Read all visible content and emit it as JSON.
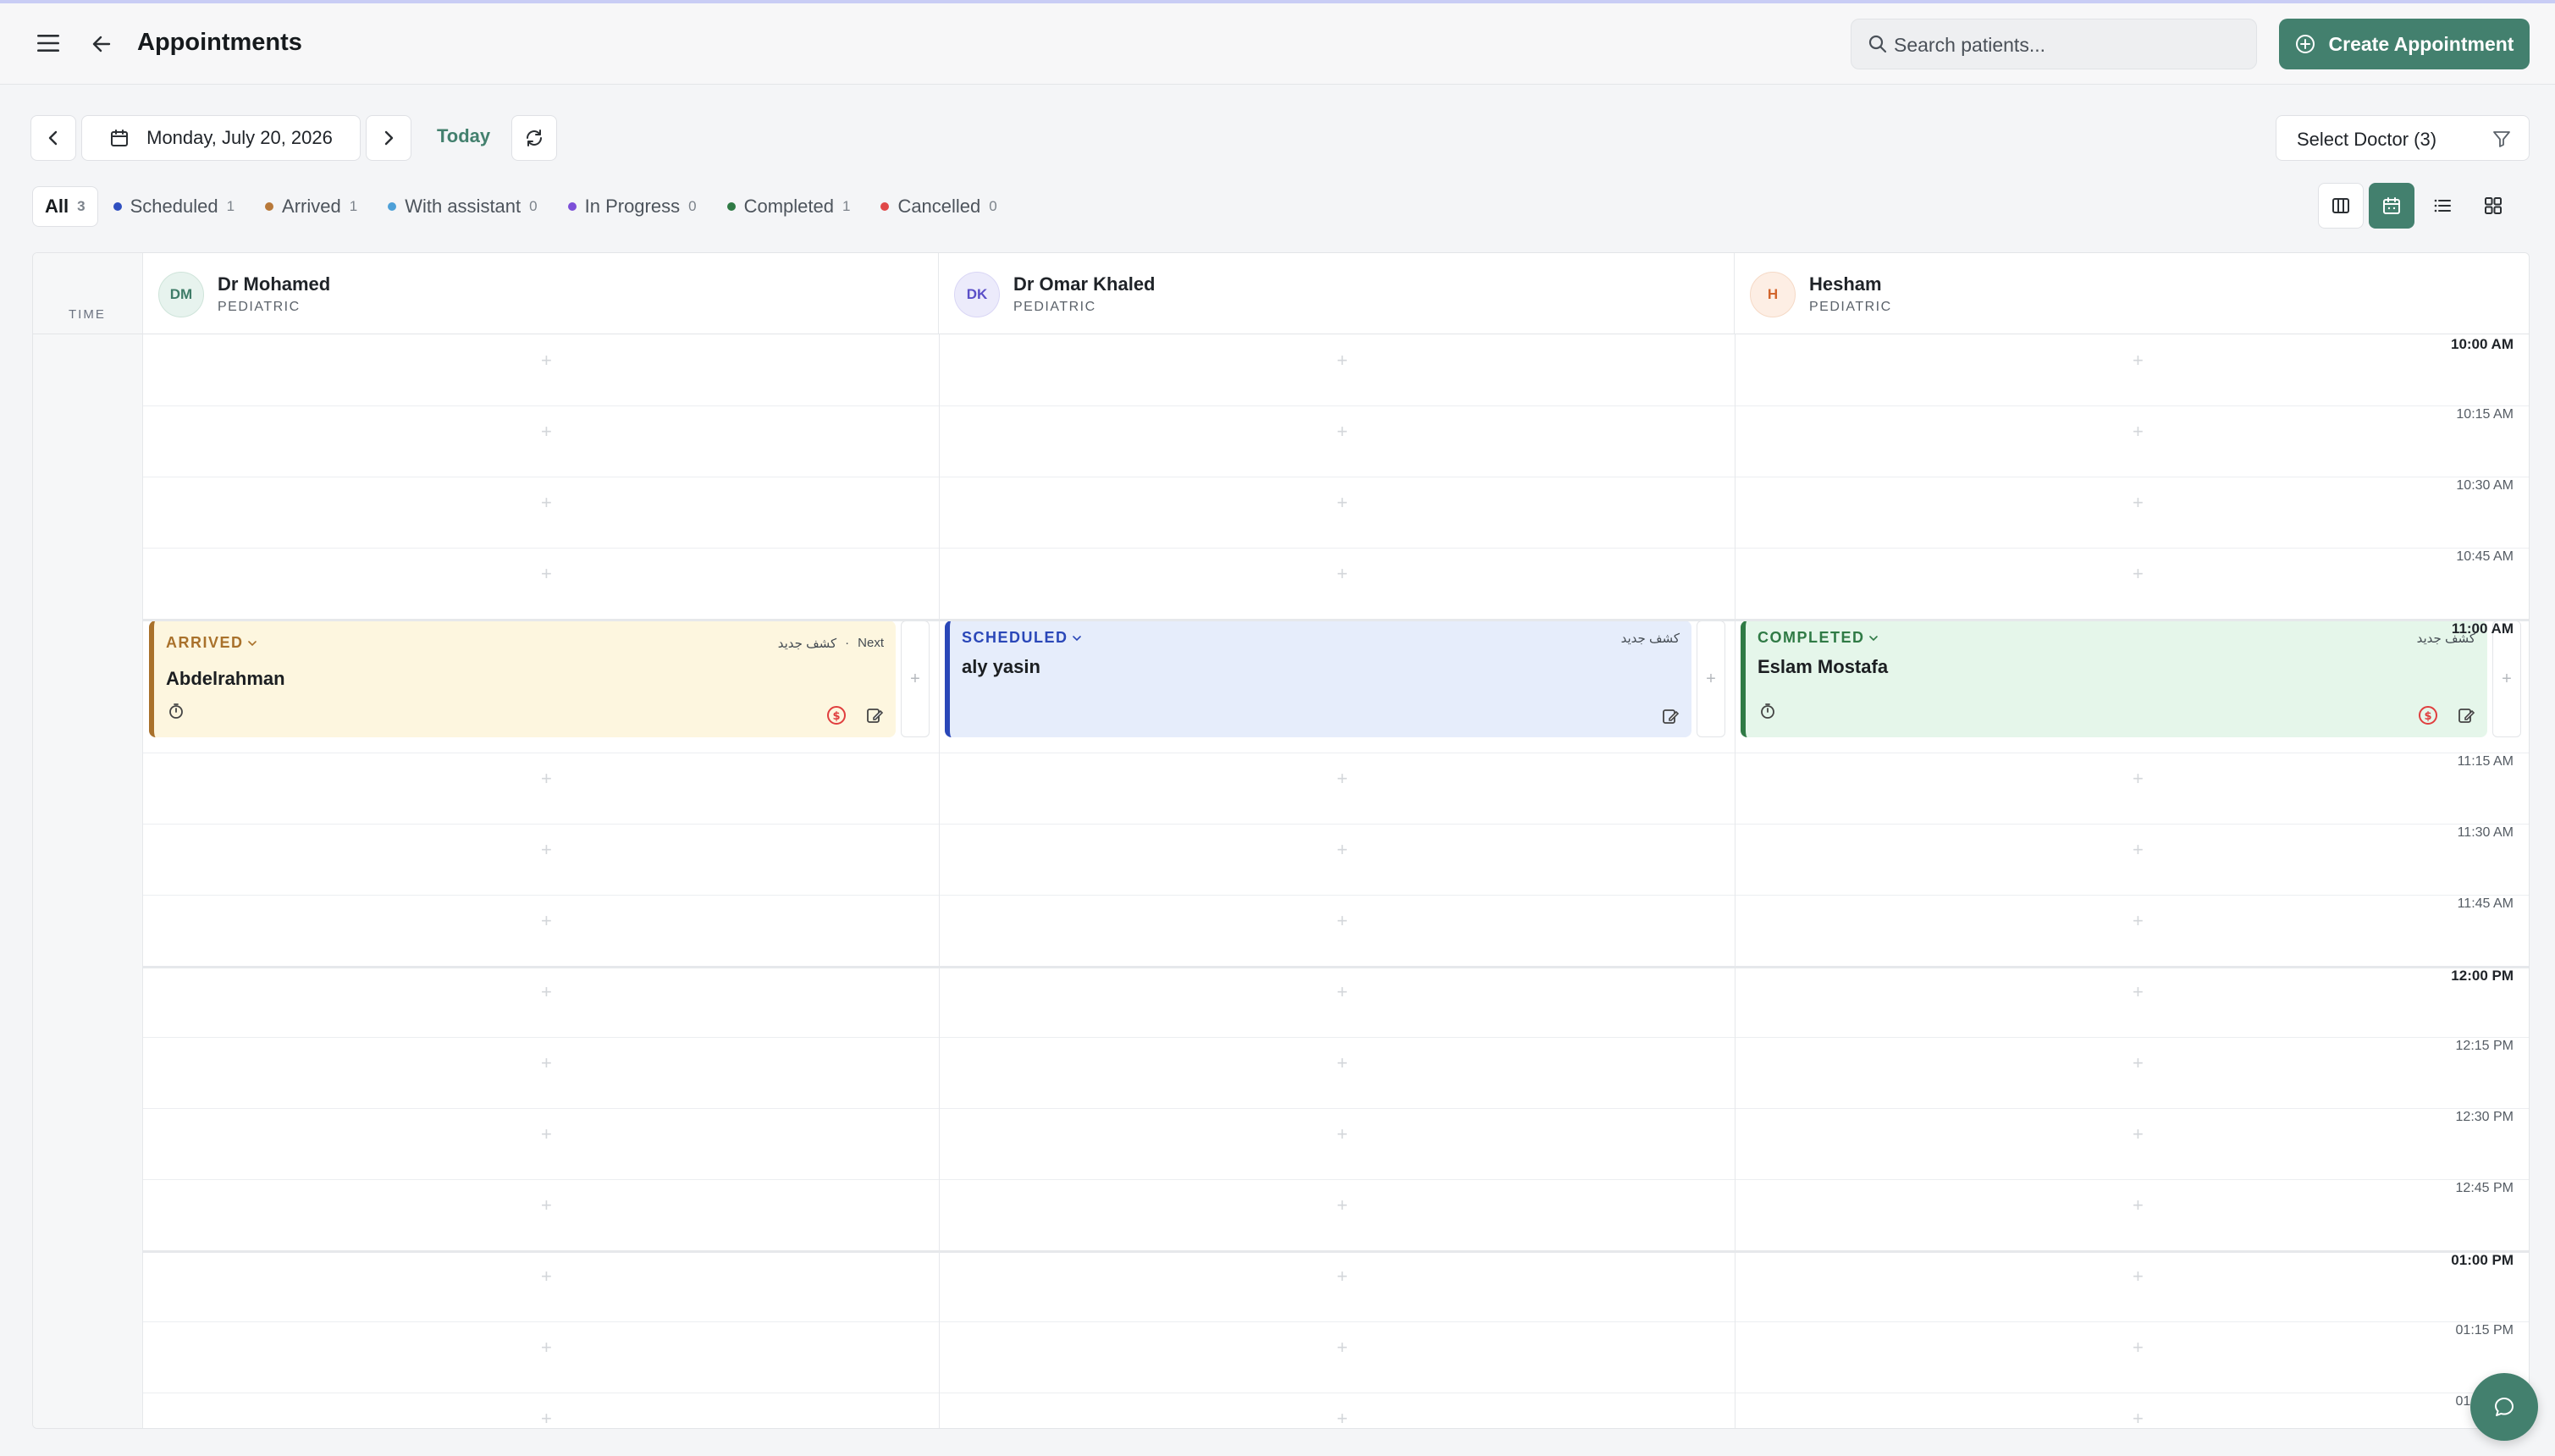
{
  "header": {
    "title": "Appointments",
    "search_placeholder": "Search patients...",
    "create_label": "Create Appointment"
  },
  "toolbar": {
    "date": "Monday, July 20, 2026",
    "today_label": "Today",
    "doctor_select": "Select Doctor (3)"
  },
  "filters": [
    {
      "label": "All",
      "count": "3",
      "color": ""
    },
    {
      "label": "Scheduled",
      "count": "1",
      "color": "#2f4fc0"
    },
    {
      "label": "Arrived",
      "count": "1",
      "color": "#b8793a"
    },
    {
      "label": "With assistant",
      "count": "0",
      "color": "#4ea0d8"
    },
    {
      "label": "In Progress",
      "count": "0",
      "color": "#7c4fd8"
    },
    {
      "label": "Completed",
      "count": "1",
      "color": "#2f7a45"
    },
    {
      "label": "Cancelled",
      "count": "0",
      "color": "#e04848"
    }
  ],
  "calendar": {
    "time_header": "TIME",
    "doctors": [
      {
        "initials": "DM",
        "name": "Dr Mohamed",
        "specialty": "PEDIATRIC",
        "avatar_bg": "#e7f3ee",
        "avatar_fg": "#3f7c68"
      },
      {
        "initials": "DK",
        "name": "Dr Omar Khaled",
        "specialty": "PEDIATRIC",
        "avatar_bg": "#ecebfb",
        "avatar_fg": "#5b4fc7"
      },
      {
        "initials": "H",
        "name": "Hesham",
        "specialty": "PEDIATRIC",
        "avatar_bg": "#fdeee4",
        "avatar_fg": "#d2652c"
      }
    ],
    "times": [
      "10:00 AM",
      "10:15 AM",
      "10:30 AM",
      "10:45 AM",
      "11:00 AM",
      "11:15 AM",
      "11:30 AM",
      "11:45 AM",
      "12:00 PM",
      "12:15 PM",
      "12:30 PM",
      "12:45 PM",
      "01:00 PM",
      "01:15 PM",
      "01:30 PM"
    ],
    "appointments": [
      {
        "status": "ARRIVED",
        "patient": "Abdelrahman",
        "visit_type": "كشف جديد",
        "tag": "Next",
        "status_color": "#a9712b",
        "bg": "#fdf6df",
        "border": "#a9712b"
      },
      {
        "status": "SCHEDULED",
        "patient": "aly yasin",
        "visit_type": "كشف جديد",
        "tag": "",
        "status_color": "#2a47b8",
        "bg": "#e6edfb",
        "border": "#2a47b8"
      },
      {
        "status": "COMPLETED",
        "patient": "Eslam Mostafa",
        "visit_type": "كشف جديد",
        "tag": "",
        "status_color": "#2f7a45",
        "bg": "#e5f6ea",
        "border": "#2f7a45"
      }
    ]
  },
  "colors": {
    "accent": "#43806e"
  }
}
